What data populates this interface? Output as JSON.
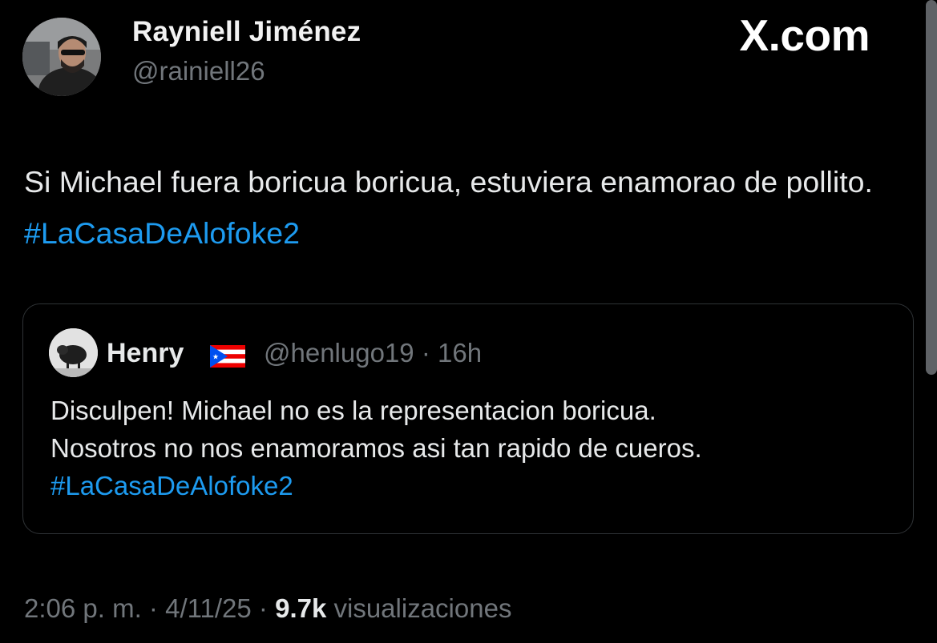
{
  "tweet": {
    "author": {
      "display_name": "Rayniell Jiménez",
      "handle": "@rainiell26"
    },
    "brand": "X.com",
    "text": "Si Michael fuera boricua boricua, estuviera enamorao de pollito.",
    "hashtag": "#LaCasaDeAlofoke2",
    "hashtag_color": "#1d9bf0",
    "time": "2:06 p. m.",
    "date": "4/11/25",
    "views_count": "9.7k",
    "views_label": "visualizaciones",
    "separator": "·"
  },
  "quoted": {
    "display_name": "Henry",
    "flag_icon": "puerto-rico-flag",
    "handle": "@henlugo19",
    "time_ago": "16h",
    "line1": "Disculpen! Michael no es la representacion boricua.",
    "line2": "Nosotros no nos enamoramos asi tan rapido de cueros.",
    "hashtag": "#LaCasaDeAlofoke2"
  },
  "colors": {
    "background": "#000000",
    "text": "#e7e9ea",
    "secondary": "#71767b",
    "border": "#2f3336",
    "link": "#1d9bf0"
  }
}
